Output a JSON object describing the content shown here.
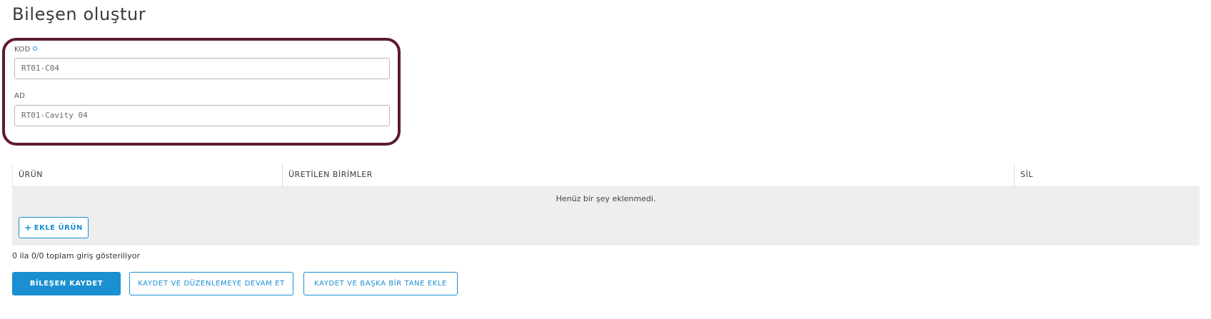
{
  "page": {
    "title": "Bileşen oluştur"
  },
  "form": {
    "code": {
      "label": "KOD",
      "value": "RT01-C04"
    },
    "name": {
      "label": "AD",
      "value": "RT01-Cavity 04"
    }
  },
  "table": {
    "columns": [
      "ÜRÜN",
      "ÜRETİLEN BİRİMLER",
      "SİL"
    ],
    "empty_message": "Henüz bir şey eklenmedi.",
    "add_button_label": "EKLE ÜRÜN"
  },
  "footer": {
    "entries_info": "0 ila 0/0 toplam giriş gösteriliyor"
  },
  "actions": {
    "save_label": "BİLEŞEN KAYDET",
    "save_continue_label": "KAYDET VE DÜZENLEMEYE DEVAM ET",
    "save_add_another_label": "KAYDET VE BAŞKA BİR TANE EKLE"
  },
  "colors": {
    "accent": "#1a8fd1",
    "highlight_border": "#5c1a33",
    "table_body_bg": "#eeeeee"
  },
  "icons": {
    "add_button_icon": "plus-icon",
    "required_marker": "required-dot-icon"
  }
}
